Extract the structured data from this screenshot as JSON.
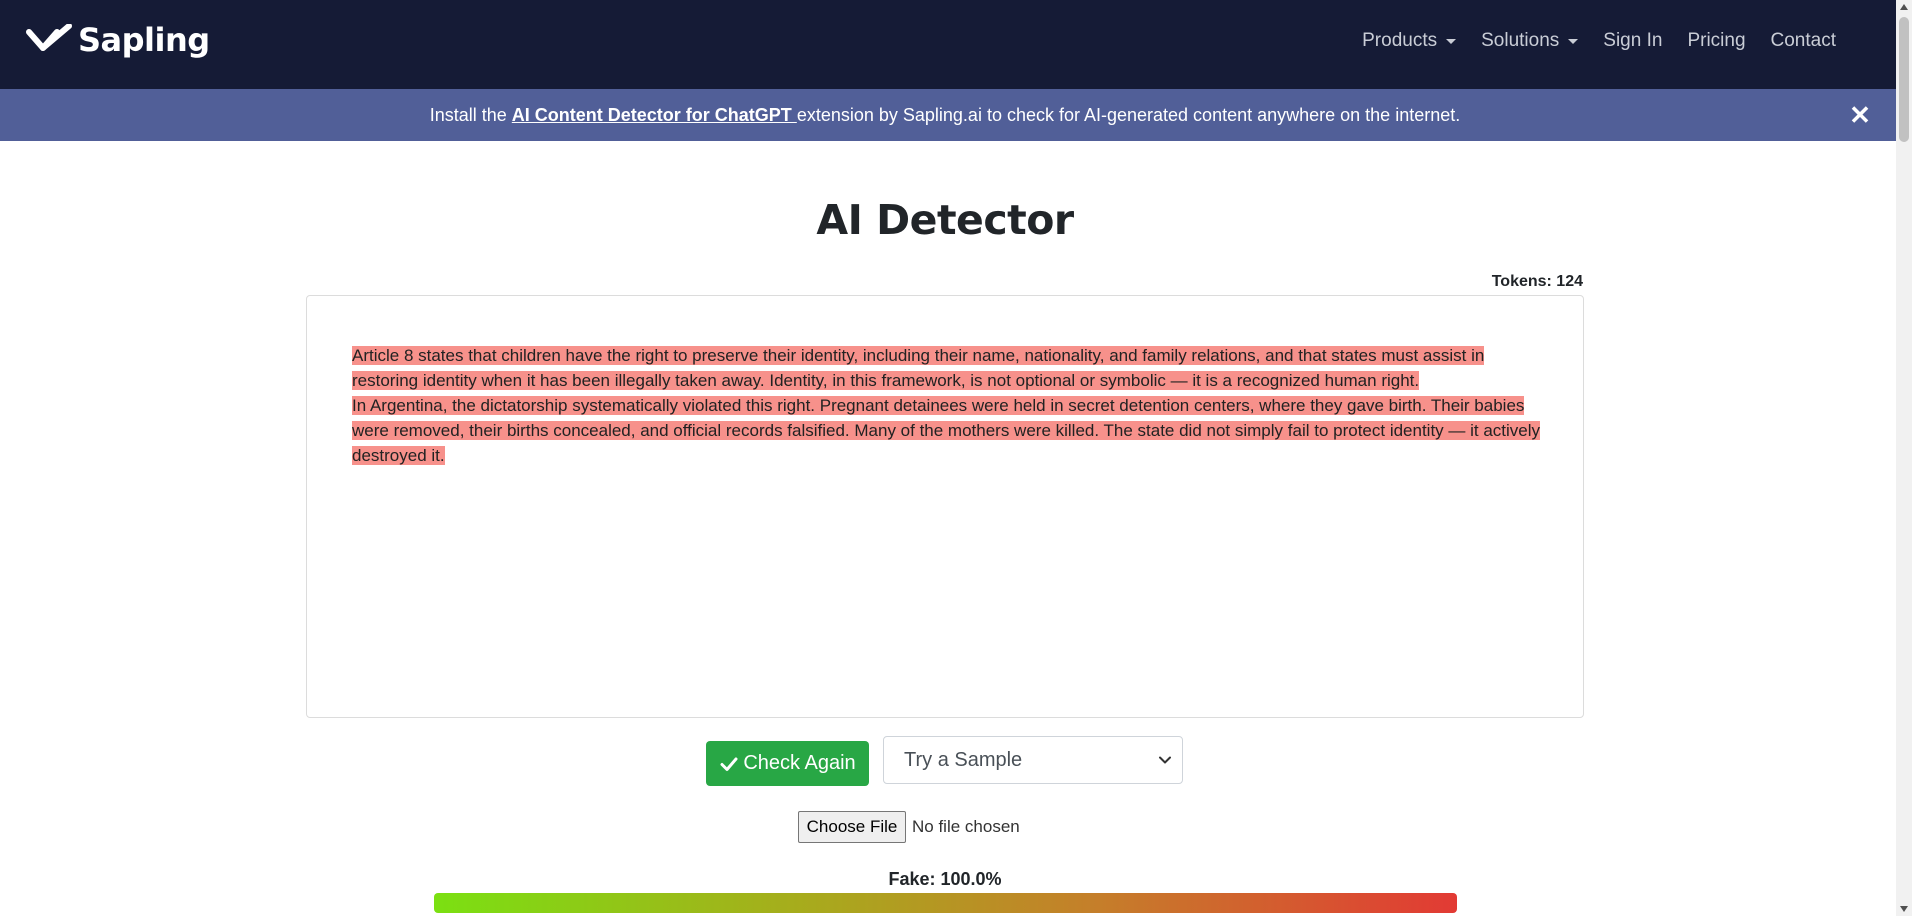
{
  "brand": {
    "name": "Sapling",
    "icon": "sapling-logo-icon"
  },
  "nav": {
    "products": "Products",
    "solutions": "Solutions",
    "sign_in": "Sign In",
    "pricing": "Pricing",
    "contact": "Contact"
  },
  "banner": {
    "prefix": "Install the ",
    "link": "AI Content Detector for ChatGPT ",
    "suffix": " extension by Sapling.ai to check for AI-generated content anywhere on the internet.",
    "close": "✕"
  },
  "page_title": "AI Detector",
  "tokens": "Tokens: 124",
  "editor": {
    "line1": "Article 8 states that children have the right to preserve their identity, including their name, nationality, and family relations, and that states must assist in restoring identity when it has been illegally taken away. Identity, in this framework, is not optional or symbolic — it is a recognized human right.",
    "line2": "In Argentina, the dictatorship systematically violated this right. Pregnant detainees were held in secret detention centers, where they gave birth. Their babies were removed, their births concealed, and official records falsified. Many of the mothers were killed. The state did not simply fail to protect identity — it actively destroyed it."
  },
  "controls": {
    "check_again": "Check Again",
    "sample_select": "Try a Sample",
    "choose_file": "Choose File",
    "file_status": "No file chosen"
  },
  "result": {
    "fake_label": "Fake: 100.0%",
    "fake_fraction": 1.0
  },
  "colors": {
    "navbar": "#151b36",
    "banner": "#515f98",
    "highlight": "#f7918b",
    "button": "#28a745"
  }
}
